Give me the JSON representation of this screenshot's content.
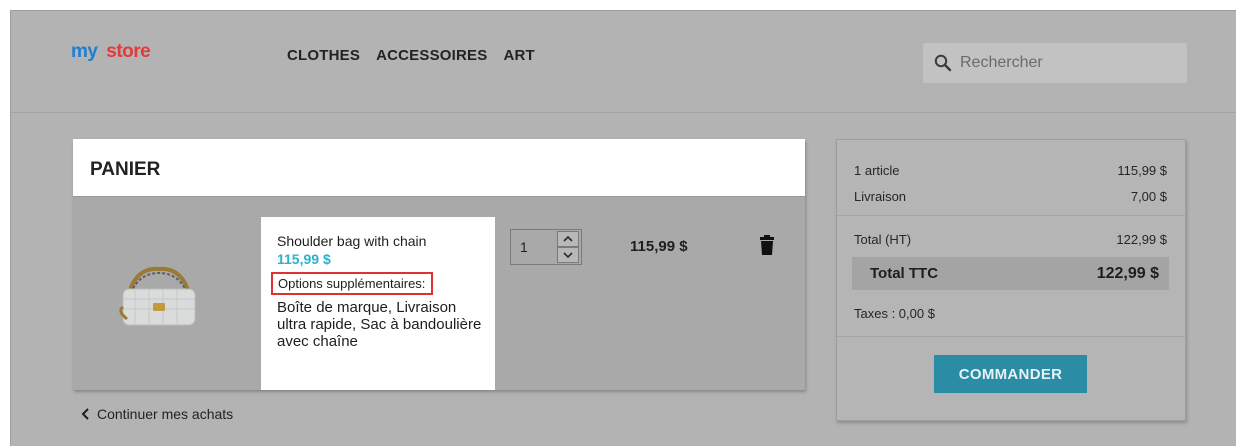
{
  "header": {
    "logo": {
      "word1": "my",
      "word2": "store",
      "colors": [
        "#1e7fd0",
        "#e53a3a",
        "#f0b21d",
        "#42a94b"
      ]
    },
    "nav": [
      "CLOTHES",
      "ACCESSOIRES",
      "ART"
    ],
    "search": {
      "placeholder": "Rechercher",
      "icon": "search-icon"
    }
  },
  "cart": {
    "title": "PANIER",
    "item": {
      "name": "Shoulder bag with chain",
      "price": "115,99 $",
      "options_label": "Options supplémentaires:",
      "options_values": "Boîte de marque, Livraison ultra rapide, Sac à bandoulière avec chaîne",
      "quantity": "1",
      "line_total": "115,99 $"
    },
    "continue_label": "Continuer mes achats"
  },
  "summary": {
    "items_label": "1 article",
    "items_value": "115,99 $",
    "shipping_label": "Livraison",
    "shipping_value": "7,00 $",
    "total_ht_label": "Total (HT)",
    "total_ht_value": "122,99 $",
    "total_ttc_label": "Total TTC",
    "total_ttc_value": "122,99 $",
    "taxes": "Taxes : 0,00 $",
    "order_button": "COMMANDER"
  },
  "colors": {
    "accent": "#2ab1cc",
    "button": "#2a8ca5",
    "highlight_border": "#e03030"
  }
}
